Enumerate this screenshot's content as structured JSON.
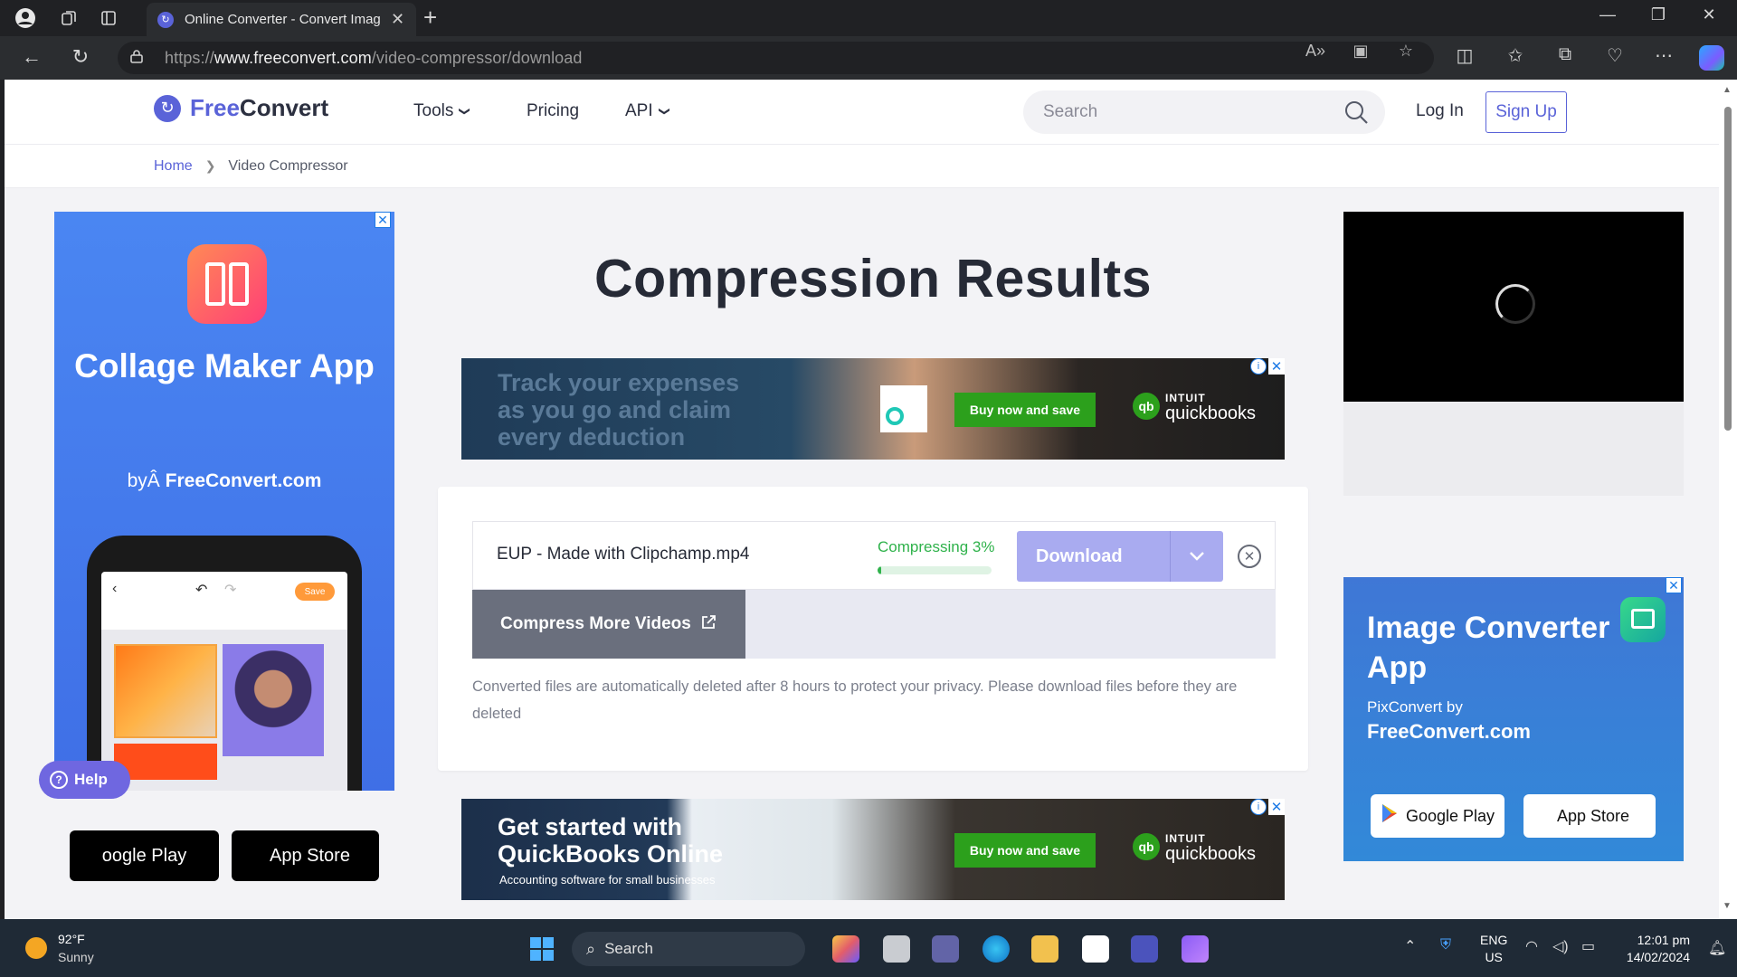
{
  "browser": {
    "tab_title": "Online Converter - Convert Imag",
    "url_prefix": "https://",
    "url_domain": "www.freeconvert.com",
    "url_path": "/video-compressor/download"
  },
  "header": {
    "logo_free": "Free",
    "logo_convert": "Convert",
    "menu": [
      {
        "label": "Tools"
      },
      {
        "label": "Pricing"
      },
      {
        "label": "API"
      }
    ],
    "search_placeholder": "Search",
    "login": "Log In",
    "signup": "Sign Up"
  },
  "breadcrumb": {
    "home": "Home",
    "current": "Video Compressor"
  },
  "main": {
    "title": "Compression Results",
    "file": {
      "name": "EUP - Made with Clipchamp.mp4",
      "status": "Compressing 3%",
      "progress_fraction": 0.03,
      "download_label": "Download"
    },
    "compress_more": "Compress More Videos",
    "note": "Converted files are automatically deleted after 8 hours to protect your privacy. Please download files before they are deleted"
  },
  "ads": {
    "top_banner": {
      "headline": [
        "Track your expenses",
        "as you go and claim",
        "every deduction"
      ],
      "cta": "Buy now and save",
      "brand_small": "INTUIT",
      "brand": "quickbooks"
    },
    "bottom_banner": {
      "headline": [
        "Get started with",
        "QuickBooks Online"
      ],
      "sub": "Accounting software for small businesses",
      "cta": "Buy now and save",
      "brand_small": "INTUIT",
      "brand": "quickbooks"
    },
    "left": {
      "title": "Collage Maker App",
      "by_prefix": "byÂ ",
      "by_brand": "FreeConvert.com",
      "phone_save": "Save",
      "google_play": "oogle Play",
      "app_store": "App Store"
    },
    "right": {
      "title": "Image Converter App",
      "by": "PixConvert by",
      "brand": "FreeConvert.com",
      "google_play": "Google Play",
      "app_store": "App Store"
    }
  },
  "help_label": "Help",
  "taskbar": {
    "temp": "92°F",
    "weather": "Sunny",
    "search": "Search",
    "lang1": "ENG",
    "lang2": "US",
    "time": "12:01 pm",
    "date": "14/02/2024"
  },
  "colors": {
    "brand": "#5a63d8",
    "progress": "#2fb24b",
    "download_disabled": "#a9abf0"
  }
}
